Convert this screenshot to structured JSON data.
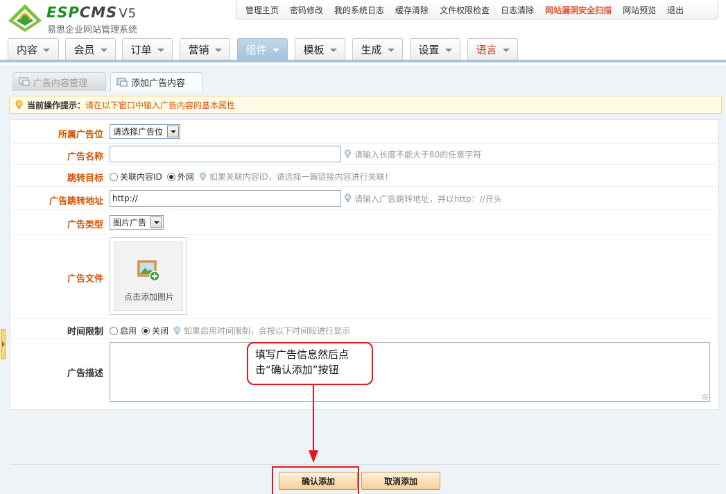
{
  "logo": {
    "brand_esp": "ESP",
    "brand_cms": "CMS",
    "brand_version": "V5",
    "subtitle": "易思企业网站管理系统"
  },
  "top_links": [
    {
      "label": "管理主页",
      "alert": false
    },
    {
      "label": "密码修改",
      "alert": false
    },
    {
      "label": "我的系统日志",
      "alert": false
    },
    {
      "label": "缓存清除",
      "alert": false
    },
    {
      "label": "文件权限检查",
      "alert": false
    },
    {
      "label": "日志清除",
      "alert": false
    },
    {
      "label": "网站漏洞安全扫描",
      "alert": true
    },
    {
      "label": "网站预览",
      "alert": false
    },
    {
      "label": "退出",
      "alert": false
    }
  ],
  "main_nav": [
    {
      "label": "内容",
      "state": "normal"
    },
    {
      "label": "会员",
      "state": "normal"
    },
    {
      "label": "订单",
      "state": "normal"
    },
    {
      "label": "营销",
      "state": "normal"
    },
    {
      "label": "组件",
      "state": "active"
    },
    {
      "label": "模板",
      "state": "normal"
    },
    {
      "label": "生成",
      "state": "normal"
    },
    {
      "label": "设置",
      "state": "normal"
    },
    {
      "label": "语言",
      "state": "highlight"
    }
  ],
  "tabs": {
    "manage": "广告内容管理",
    "add": "添加广告内容"
  },
  "tip": {
    "label": "当前操作提示：",
    "text": "请在以下窗口中输入广告内容的基本属性"
  },
  "form": {
    "position": {
      "label": "所属广告位",
      "value": "请选择广告位"
    },
    "name": {
      "label": "广告名称",
      "value": "",
      "hint": "请输入长度不能大于80的任意字符"
    },
    "target": {
      "label": "跳转目标",
      "options": [
        {
          "label": "关联内容ID",
          "selected": false
        },
        {
          "label": "外网",
          "selected": true
        }
      ],
      "hint": "如果关联内容ID，请选择一篇链接内容进行关联！"
    },
    "url": {
      "label": "广告跳转地址",
      "value": "http://",
      "hint": "请输入广告跳转地址，并以http：//开头"
    },
    "type": {
      "label": "广告类型",
      "value": "图片广告"
    },
    "file": {
      "label": "广告文件",
      "upload_text": "点击添加图片"
    },
    "time_limit": {
      "label": "时间限制",
      "options": [
        {
          "label": "启用",
          "selected": false
        },
        {
          "label": "关闭",
          "selected": true
        }
      ],
      "hint": "如果启用时间限制，会按以下时间段进行显示"
    },
    "description": {
      "label": "广告描述",
      "value": ""
    }
  },
  "buttons": {
    "confirm": "确认添加",
    "cancel": "取消添加"
  },
  "annotation": {
    "callout_line1": "填写广告信息然后点",
    "callout_line2": "击“确认添加”按钮"
  },
  "colors": {
    "alert_text": "#e4572e",
    "label_orange": "#d35400",
    "nav_active": "#a6c1dc",
    "annotation_red": "#e3171d",
    "button_fill": "#f7cf96"
  }
}
